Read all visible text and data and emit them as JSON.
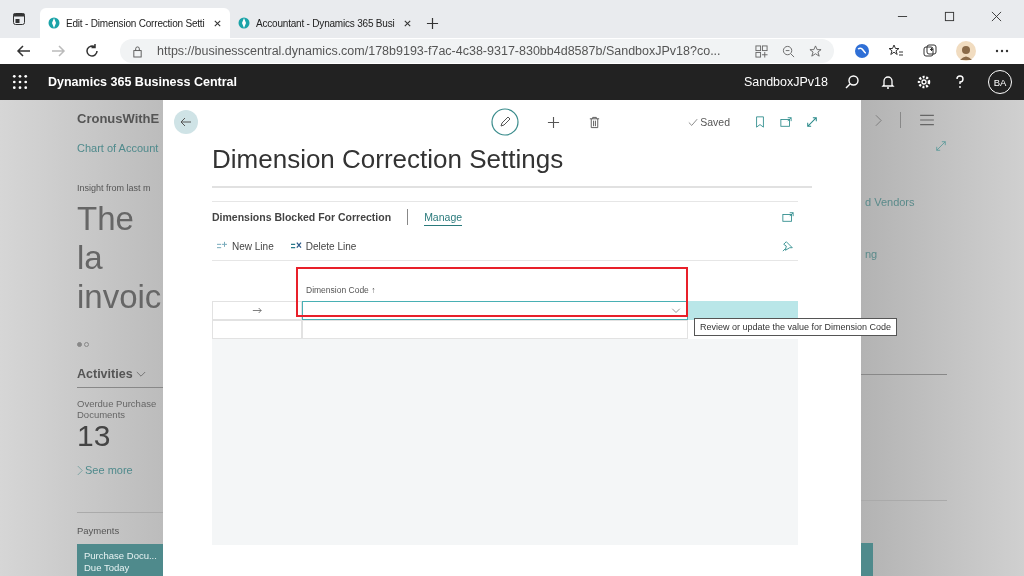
{
  "browser": {
    "tabs": [
      {
        "title": "Edit - Dimension Correction Setti",
        "selected": true
      },
      {
        "title": "Accountant - Dynamics 365 Busi",
        "selected": false
      }
    ],
    "url": "https://businesscentral.dynamics.com/178b9193-f7ac-4c38-9317-830bb4d8587b/SandboxJPv18?co..."
  },
  "app_bar": {
    "title": "Dynamics 365 Business Central",
    "environment": "SandboxJPv18",
    "avatar": "BA"
  },
  "background_page": {
    "company": "CronusWithE",
    "link": "Chart of Account",
    "insight": "Insight from last m",
    "headline": "The la invoic",
    "pager": [
      {
        "selected": true
      },
      {
        "selected": false
      }
    ],
    "activities": "Activities",
    "tile": {
      "label": "Overdue Purchase Documents",
      "value": "13",
      "see_more": "See more"
    },
    "payments": "Payments",
    "payment_tile": "Purchase Docu... Due Today",
    "right_links": [
      "d Vendors",
      "ng"
    ]
  },
  "dialog": {
    "status": "Saved",
    "title": "Dimension Correction Settings",
    "part": {
      "title": "Dimensions Blocked For Correction",
      "tabs": [
        {
          "label": "Manage",
          "selected": true
        }
      ],
      "actions": [
        {
          "kind": "new",
          "label": "New Line"
        },
        {
          "kind": "delete",
          "label": "Delete Line"
        }
      ],
      "column": {
        "label": "Dimension Code ↑",
        "highlighted": true
      },
      "rows": [
        {
          "selected": true
        },
        {
          "selected": false
        }
      ],
      "tooltip": "Review or update the value for Dimension Code"
    }
  }
}
